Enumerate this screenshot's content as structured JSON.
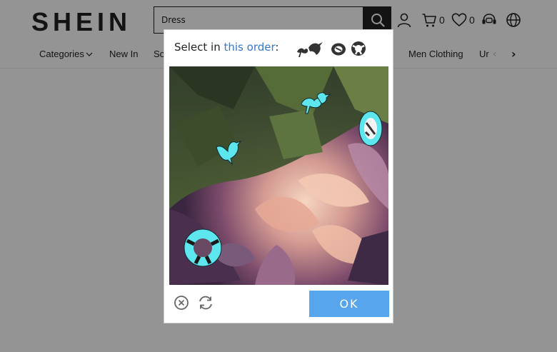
{
  "header": {
    "logo": "SHEIN",
    "search_value": "Dress",
    "cart_count": "0",
    "wishlist_count": "0"
  },
  "nav": {
    "items": [
      "Categories",
      "New In",
      "So",
      "Men Clothing",
      "Ur"
    ]
  },
  "captcha": {
    "instruction_prefix": "Select in ",
    "instruction_link": "this order",
    "instruction_suffix": ":",
    "order_icons": [
      "hummingbird-flower-icon",
      "tray-dish-icon",
      "lifebuoy-icon"
    ],
    "targets": [
      "dove-icon",
      "hummingbird-flower-icon",
      "lifebuoy-icon",
      "tray-dish-icon"
    ],
    "ok_label": "OK",
    "accent_color": "#3478c6",
    "button_color": "#57a5ec",
    "target_color": "#5ee6ef"
  }
}
